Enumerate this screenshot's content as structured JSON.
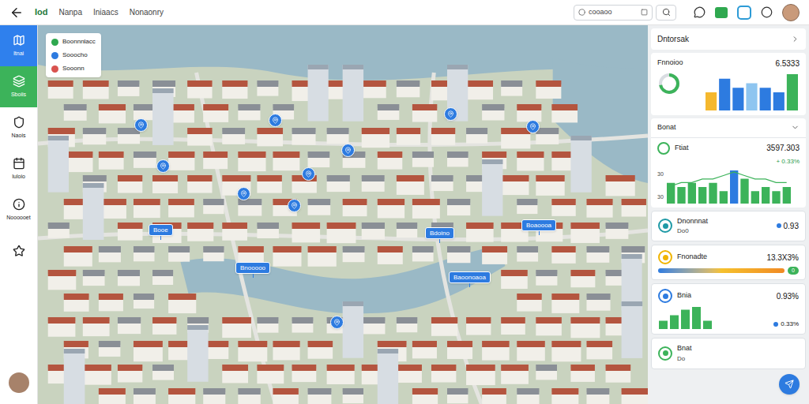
{
  "top_bar": {
    "nav": [
      {
        "label": "Iod",
        "selected": true
      },
      {
        "label": "Nanpa",
        "selected": false
      },
      {
        "label": "Iniaacs",
        "selected": false
      },
      {
        "label": "Nonaonry",
        "selected": false
      }
    ],
    "search": {
      "value": "cooaoo"
    }
  },
  "sidebar": {
    "items": [
      {
        "label": "Itnai",
        "selected": true,
        "color": "#2f80ed"
      },
      {
        "label": "Sboiis",
        "selected": true,
        "color": "#3cb35a"
      },
      {
        "label": "Naois",
        "selected": false,
        "color": "#ffffff"
      },
      {
        "label": "Iuloio",
        "selected": false,
        "color": "#ffffff"
      },
      {
        "label": "Noooooet",
        "selected": false,
        "color": "#ffffff"
      },
      {
        "label": "",
        "selected": false,
        "color": "#ffffff"
      }
    ]
  },
  "legend": [
    {
      "label": "Boonnnlacc",
      "color": "#2fa84f"
    },
    {
      "label": "Sooocho",
      "color": "#2d7be0"
    },
    {
      "label": "Sooonn",
      "color": "#d9534f"
    }
  ],
  "pins": [
    {
      "kind": "icon",
      "label": ""
    },
    {
      "kind": "icon",
      "label": ""
    },
    {
      "kind": "icon",
      "label": ""
    },
    {
      "kind": "icon",
      "label": ""
    },
    {
      "kind": "icon",
      "label": ""
    },
    {
      "kind": "icon",
      "label": ""
    },
    {
      "kind": "icon",
      "label": ""
    },
    {
      "kind": "icon",
      "label": ""
    },
    {
      "kind": "icon",
      "label": ""
    },
    {
      "kind": "label",
      "label": "Booe"
    },
    {
      "kind": "label",
      "label": "Bdoino"
    },
    {
      "kind": "label",
      "label": "Boaoooa"
    },
    {
      "kind": "label",
      "label": "Baoonoaoa"
    },
    {
      "kind": "label",
      "label": "Bnooooo"
    },
    {
      "kind": "icon",
      "label": ""
    }
  ],
  "panel": {
    "title": "Dntorsak",
    "summary": {
      "name": "Fnnoioo",
      "value": "6.5333",
      "donut_level": 0.72,
      "bars": [
        {
          "value": 4,
          "color": "#f5b82e"
        },
        {
          "value": 7,
          "color": "#2d7be0"
        },
        {
          "value": 5,
          "color": "#2d7be0"
        },
        {
          "value": 6,
          "color": "#8ec5f0"
        },
        {
          "value": 5,
          "color": "#2d7be0"
        },
        {
          "value": 4,
          "color": "#2d7be0"
        },
        {
          "value": 8,
          "color": "#3cb35a"
        }
      ]
    },
    "section": {
      "title": "Bonat",
      "name": "Ftiat",
      "value": "3597.303",
      "change": "+ 0.33%",
      "ticks": [
        "30",
        "30"
      ],
      "bars": [
        {
          "value": 5,
          "color": "#3cb35a"
        },
        {
          "value": 4,
          "color": "#3cb35a"
        },
        {
          "value": 5,
          "color": "#3cb35a"
        },
        {
          "value": 4,
          "color": "#3cb35a"
        },
        {
          "value": 5,
          "color": "#3cb35a"
        },
        {
          "value": 3,
          "color": "#3cb35a"
        },
        {
          "value": 8,
          "color": "#2d7be0"
        },
        {
          "value": 6,
          "color": "#3cb35a"
        },
        {
          "value": 3,
          "color": "#3cb35a"
        },
        {
          "value": 4,
          "color": "#3cb35a"
        },
        {
          "value": 3,
          "color": "#3cb35a"
        },
        {
          "value": 4,
          "color": "#3cb35a"
        }
      ],
      "line": [
        5,
        6,
        6,
        7,
        7,
        8,
        9,
        8,
        7,
        7,
        6,
        6
      ]
    },
    "cards": [
      {
        "kind": "plain",
        "name": "Dnonnnat",
        "sub": "Do0",
        "value": "0.93",
        "color": "#1f9aa6"
      },
      {
        "kind": "gradient",
        "name": "Fnonadte",
        "sub": "",
        "value": "13.3X3%",
        "badge": "0",
        "color": "#f0b400"
      },
      {
        "kind": "bars",
        "name": "Bnia",
        "sub": "",
        "value": "0.93%",
        "value2": "0.33%",
        "bars": [
          3,
          5,
          7,
          8,
          3
        ],
        "color": "#2d7be0"
      },
      {
        "kind": "plain",
        "name": "Bnat",
        "sub": "Do",
        "value": "",
        "color": "#3cb35a"
      }
    ]
  }
}
